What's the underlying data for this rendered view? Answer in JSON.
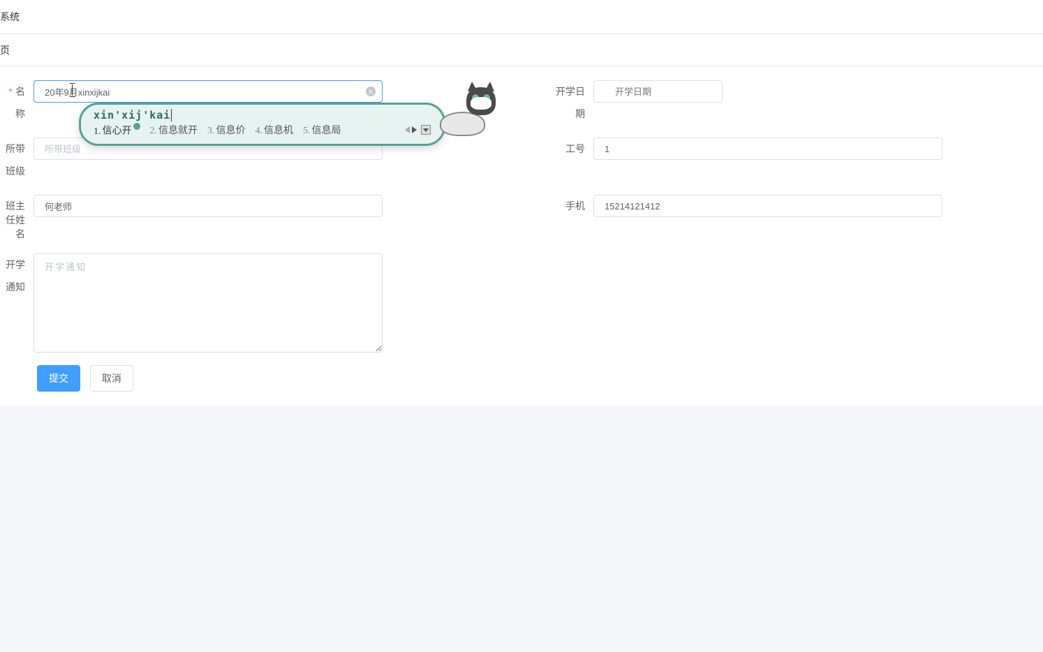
{
  "header": {
    "title": "系统"
  },
  "breadcrumb": {
    "text": "页"
  },
  "form": {
    "name": {
      "label": "名称",
      "value": "20年9月xinxijkai"
    },
    "openDate": {
      "label": "开学日期",
      "placeholder": "开学日期"
    },
    "classAssigned": {
      "label": "所带班级",
      "placeholder": "所带班级"
    },
    "workId": {
      "label": "工号",
      "value": "1"
    },
    "teacherName": {
      "label": "班主任姓名",
      "value": "何老师"
    },
    "phone": {
      "label": "手机",
      "value": "15214121412"
    },
    "notice": {
      "label": "开学通知",
      "placeholder": "开学通知"
    }
  },
  "buttons": {
    "submit": "提交",
    "cancel": "取消"
  },
  "ime": {
    "pinyin": "xin'xij'kai",
    "candidates": [
      {
        "num": "1.",
        "text": "信心开"
      },
      {
        "num": "2.",
        "text": "信息就开"
      },
      {
        "num": "3.",
        "text": "信息价"
      },
      {
        "num": "4.",
        "text": "信息机"
      },
      {
        "num": "5.",
        "text": "信息局"
      }
    ]
  }
}
